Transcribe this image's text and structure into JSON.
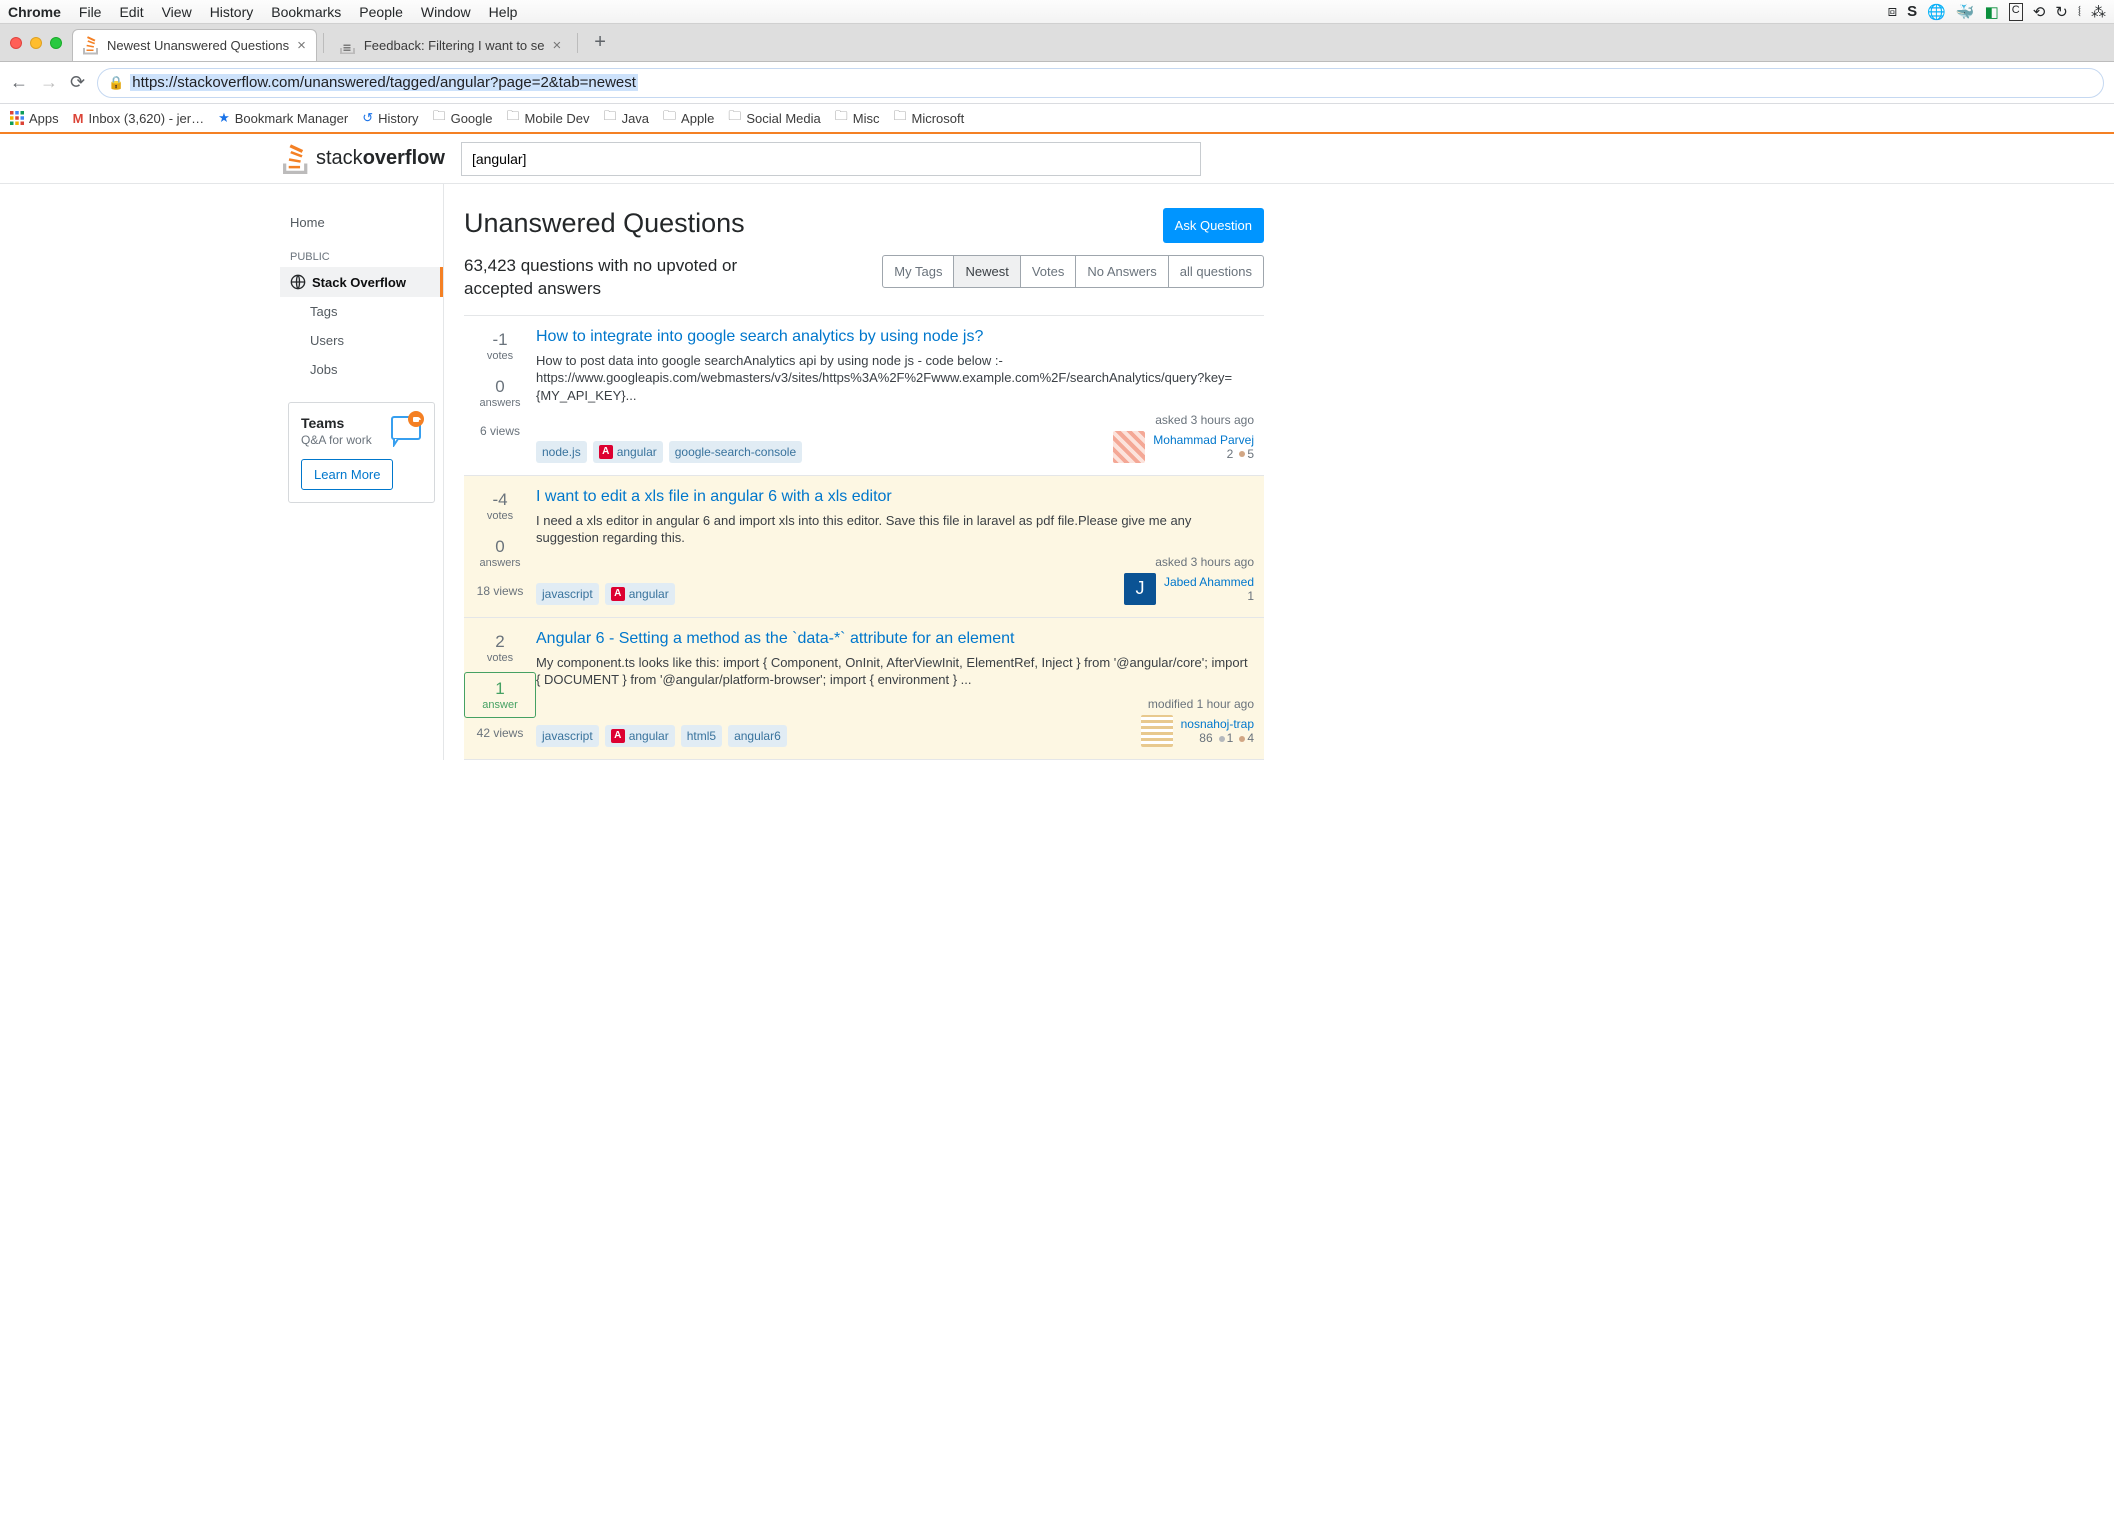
{
  "mac_menu": {
    "app": "Chrome",
    "items": [
      "File",
      "Edit",
      "View",
      "History",
      "Bookmarks",
      "People",
      "Window",
      "Help"
    ]
  },
  "tabs": [
    {
      "title": "Newest Unanswered Questions",
      "active": true
    },
    {
      "title": "Feedback: Filtering I want to se",
      "active": false
    }
  ],
  "url": "https://stackoverflow.com/unanswered/tagged/angular?page=2&tab=newest",
  "bookmarks": {
    "apps": "Apps",
    "inbox": "Inbox (3,620) - jer…",
    "bm_manager": "Bookmark Manager",
    "history": "History",
    "folders": [
      "Google",
      "Mobile Dev",
      "Java",
      "Apple",
      "Social Media",
      "Misc",
      "Microsoft"
    ]
  },
  "so": {
    "search_value": "[angular]",
    "left_nav": {
      "home": "Home",
      "public": "PUBLIC",
      "so": "Stack Overflow",
      "tags": "Tags",
      "users": "Users",
      "jobs": "Jobs"
    },
    "teams": {
      "title": "Teams",
      "sub": "Q&A for work",
      "learn": "Learn More"
    },
    "page_title": "Unanswered Questions",
    "ask": "Ask Question",
    "count_text": "63,423 questions with no upvoted or accepted answers",
    "filters": [
      "My Tags",
      "Newest",
      "Votes",
      "No Answers",
      "all questions"
    ],
    "active_filter": "Newest",
    "questions": [
      {
        "votes": "-1",
        "answers": "0",
        "answers_has": false,
        "views": "6 views",
        "highlight": false,
        "title": "How to integrate into google search analytics by using node js?",
        "excerpt": "How to post data into google searchAnalytics api by using node js - code below :- https://www.googleapis.com/webmasters/v3/sites/https%3A%2F%2Fwww.example.com%2F/searchAnalytics/query?key={MY_API_KEY}...",
        "tags": [
          {
            "label": "node.js",
            "ng": false
          },
          {
            "label": "angular",
            "ng": true
          },
          {
            "label": "google-search-console",
            "ng": false
          }
        ],
        "meta_when": "asked 3 hours ago",
        "meta_user": "Mohammad Parvej",
        "meta_rep": "2",
        "badges": [
          {
            "type": "bronze",
            "count": "5"
          }
        ],
        "avatar_bg": "repeating-linear-gradient(45deg,#f4a896,#f4a896 4px,#fce3dc 4px,#fce3dc 8px)"
      },
      {
        "votes": "-4",
        "answers": "0",
        "answers_has": false,
        "views": "18 views",
        "highlight": true,
        "title": "I want to edit a xls file in angular 6 with a xls editor",
        "excerpt": "I need a xls editor in angular 6 and import xls into this editor. Save this file in laravel as pdf file.Please give me any suggestion regarding this.",
        "tags": [
          {
            "label": "javascript",
            "ng": false
          },
          {
            "label": "angular",
            "ng": true
          }
        ],
        "meta_when": "asked 3 hours ago",
        "meta_user": "Jabed Ahammed",
        "meta_rep": "1",
        "badges": [],
        "avatar_bg": "#0b5394",
        "avatar_letter": "J"
      },
      {
        "votes": "2",
        "answers": "1",
        "answers_has": true,
        "views": "42 views",
        "highlight": true,
        "title": "Angular 6 - Setting a method as the `data-*` attribute for an element",
        "excerpt": "My component.ts looks like this: import { Component, OnInit, AfterViewInit, ElementRef, Inject } from '@angular/core'; import { DOCUMENT } from '@angular/platform-browser'; import { environment } ...",
        "tags": [
          {
            "label": "javascript",
            "ng": false
          },
          {
            "label": "angular",
            "ng": true
          },
          {
            "label": "html5",
            "ng": false
          },
          {
            "label": "angular6",
            "ng": false
          }
        ],
        "meta_when": "modified 1 hour ago",
        "meta_user": "nosnahoj-trap",
        "meta_rep": "86",
        "badges": [
          {
            "type": "silver",
            "count": "1"
          },
          {
            "type": "bronze",
            "count": "4"
          }
        ],
        "avatar_bg": "repeating-linear-gradient(0deg,#e8c98e,#e8c98e 3px,#fff 3px,#fff 6px)"
      }
    ]
  }
}
